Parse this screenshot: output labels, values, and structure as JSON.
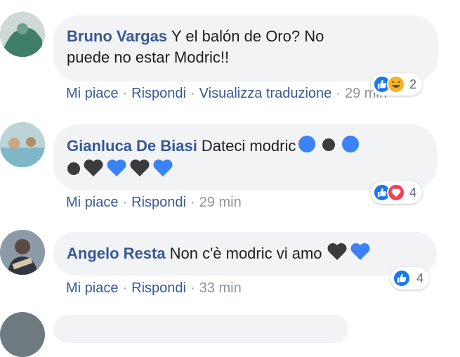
{
  "comments": [
    {
      "author": "Bruno Vargas",
      "text_line1": "Y el balón de Oro? No",
      "text_line2": "puede no estar Modric!!",
      "actions": {
        "like": "Mi piace",
        "reply": "Rispondi",
        "translate": "Visualizza traduzione",
        "time": "29 min"
      },
      "reactions": {
        "types": [
          "like-icon",
          "haha-icon"
        ],
        "count": "2"
      }
    },
    {
      "author": "Gianluca De Biasi",
      "text_line1": "Dateci modric",
      "emoji_line1": [
        "blue-circle",
        "black-circle",
        "blue-circle"
      ],
      "emoji_line2": [
        "black-circle",
        "black-heart",
        "blue-heart",
        "black-heart",
        "blue-heart"
      ],
      "actions": {
        "like": "Mi piace",
        "reply": "Rispondi",
        "time": "29 min"
      },
      "reactions": {
        "types": [
          "like-icon",
          "love-icon"
        ],
        "count": "4"
      }
    },
    {
      "author": "Angelo Resta",
      "text_line1": "Non c'è modric vi amo",
      "emoji_line1": [
        "black-heart",
        "blue-heart"
      ],
      "actions": {
        "like": "Mi piace",
        "reply": "Rispondi",
        "time": "33 min"
      },
      "reactions": {
        "types": [
          "like-icon"
        ],
        "count": "4"
      }
    }
  ],
  "separator": "·",
  "colors": {
    "link": "#385898",
    "bubble": "#f2f3f5",
    "meta": "#90949c",
    "like": "#1877f2",
    "love": "#f33e58",
    "haha": "#f7b125"
  }
}
